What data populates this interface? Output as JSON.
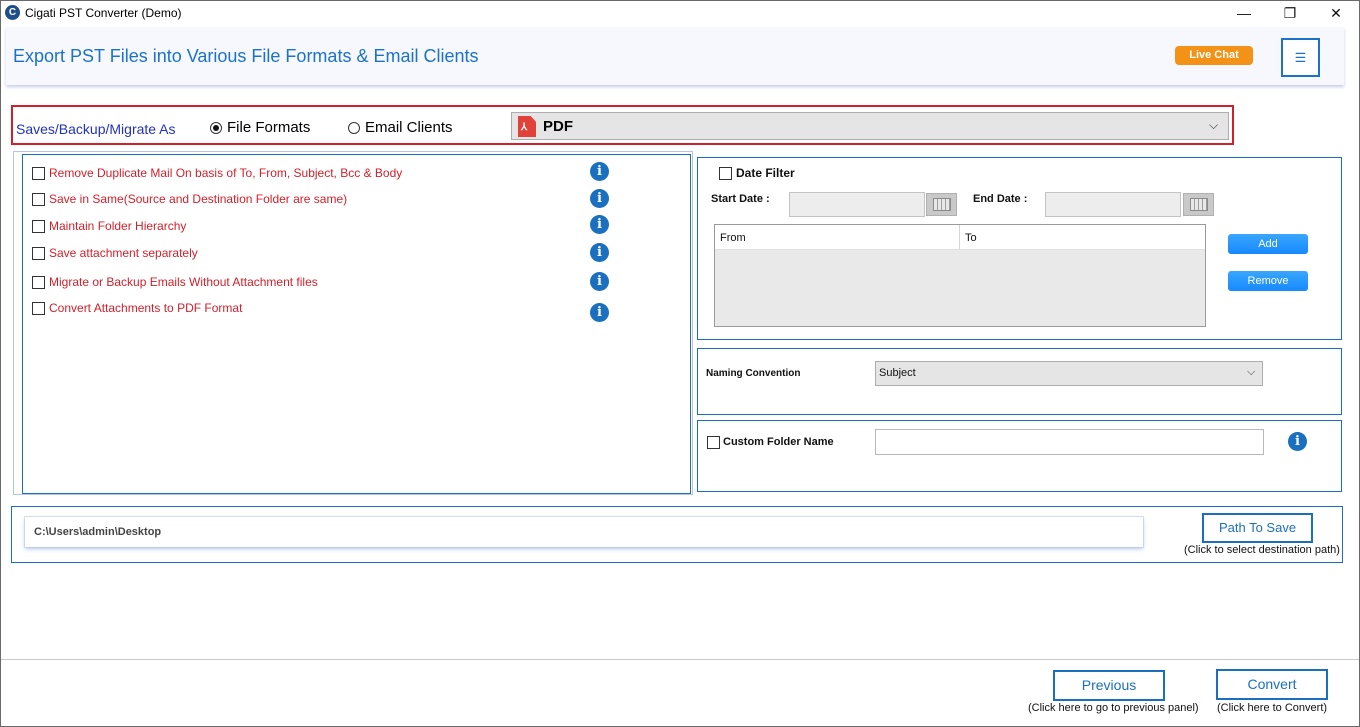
{
  "window": {
    "title": "Cigati PST Converter (Demo)",
    "controls": {
      "minimize": "—",
      "maximize": "❐",
      "close": "✕"
    }
  },
  "header": {
    "title": "Export PST Files into Various File Formats & Email Clients",
    "live_chat": "Live Chat",
    "menu_icon": "hamburger-icon",
    "menu_glyph": "☰"
  },
  "save_as": {
    "label": "Saves/Backup/Migrate As",
    "options": [
      {
        "label": "File Formats",
        "selected": true
      },
      {
        "label": "Email Clients",
        "selected": false
      }
    ],
    "format_selected": "PDF",
    "format_icon": "pdf-file-icon",
    "chevron": "⌵"
  },
  "options": [
    {
      "label": "Remove Duplicate Mail On basis of To, From, Subject, Bcc & Body",
      "checked": false
    },
    {
      "label": "Save in Same(Source and Destination Folder are same)",
      "checked": false
    },
    {
      "label": "Maintain Folder Hierarchy",
      "checked": false
    },
    {
      "label": "Save attachment separately",
      "checked": false
    },
    {
      "label": "Migrate or Backup Emails Without Attachment files",
      "checked": false
    },
    {
      "label": "Convert Attachments to PDF Format",
      "checked": false
    }
  ],
  "info_glyph": "i",
  "date_filter": {
    "label": "Date Filter",
    "checked": false,
    "start_label": "Start Date :",
    "end_label": "End Date :",
    "start_value": "",
    "end_value": "",
    "columns": [
      "From",
      "To"
    ],
    "add_label": "Add",
    "remove_label": "Remove"
  },
  "naming": {
    "label": "Naming Convention",
    "selected": "Subject"
  },
  "custom_folder": {
    "label": "Custom Folder Name",
    "checked": false,
    "value": ""
  },
  "path": {
    "value": "C:\\Users\\admin\\Desktop",
    "button": "Path To Save",
    "hint": "(Click to select destination path)"
  },
  "footer": {
    "previous": "Previous",
    "previous_hint": "(Click here to go to previous panel)",
    "convert": "Convert",
    "convert_hint": "(Click here to Convert)"
  },
  "colors": {
    "accent": "#1a73c9",
    "option_text": "#d21f2a",
    "highlight_border": "#d21f2a",
    "live_chat": "#f39216"
  }
}
